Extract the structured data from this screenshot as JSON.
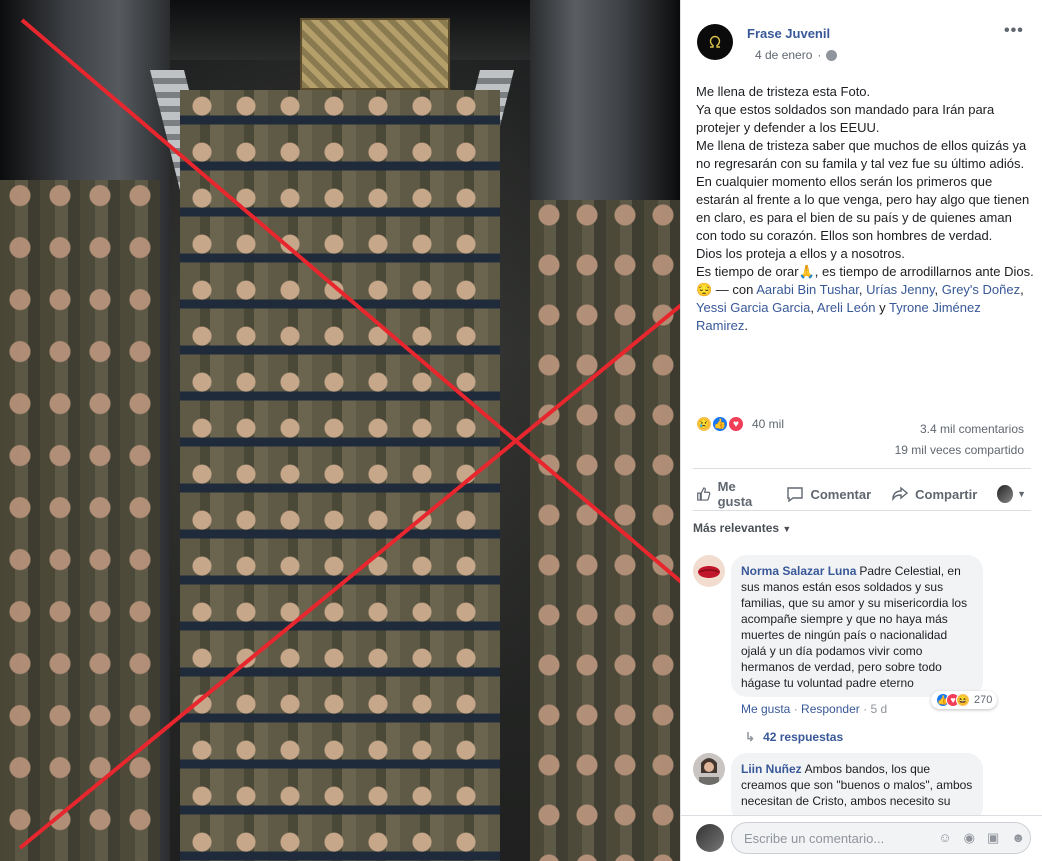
{
  "post": {
    "page_name": "Frase Juvenil",
    "date": "4 de enero",
    "more": "•••",
    "text_lines": [
      "Me llena de tristeza esta Foto.",
      "Ya que estos soldados son mandado para Irán para protejer y defender a los EEUU.",
      "Me llena de tristeza saber que muchos de ellos quizás ya no regresarán con su famila y tal vez fue su último adiós.",
      "En cualquier momento ellos serán los primeros que estarán al frente a lo que venga, pero hay algo que tienen en claro, es para el bien de su país y de quienes aman con todo su corazón. Ellos son hombres de verdad.",
      "Dios los proteja a ellos y a nosotros."
    ],
    "last_line_a": "Es tiempo de orar🙏, es tiempo de arrodillarnos ante Dios. 😔 — con ",
    "tags": [
      "Aarabi Bin Tushar",
      "Urías Jenny",
      "Grey's Doñez",
      "Yessi Garcia Garcia",
      "Areli León",
      "Tyrone Jiménez Ramirez"
    ],
    "tag_sep": ", ",
    "tag_and": " y ",
    "tag_end": "."
  },
  "engagement": {
    "reaction_icons": [
      "sad-icon",
      "like-icon",
      "love-icon"
    ],
    "reactions_count": "40 mil",
    "comments": "3.4 mil comentarios",
    "shares": "19 mil veces compartido"
  },
  "actions": {
    "like": "Me gusta",
    "comment": "Comentar",
    "share": "Compartir"
  },
  "sort": {
    "label": "Más relevantes"
  },
  "comments": [
    {
      "name": "Norma Salazar Luna",
      "text": "Padre Celestial, en sus manos están esos soldados y sus familias, que su amor y su misericordia los acompañe siempre y que no haya más muertes de ningún país o nacionalidad ojalá y un día podamos vivir como hermanos de verdad, pero sobre todo hágase tu voluntad padre eterno",
      "reactions": "270",
      "like": "Me gusta",
      "reply": "Responder",
      "time": "5 d",
      "replies": "42 respuestas"
    },
    {
      "name": "Liin Nuñez",
      "text": "Ambos bandos, los que creamos que son \"buenos o malos\", ambos necesitan de Cristo, ambos necesito su"
    }
  ],
  "composer": {
    "placeholder": "Escribe un comentario..."
  },
  "colors": {
    "link": "#385898",
    "x_mark": "#e8262e"
  }
}
